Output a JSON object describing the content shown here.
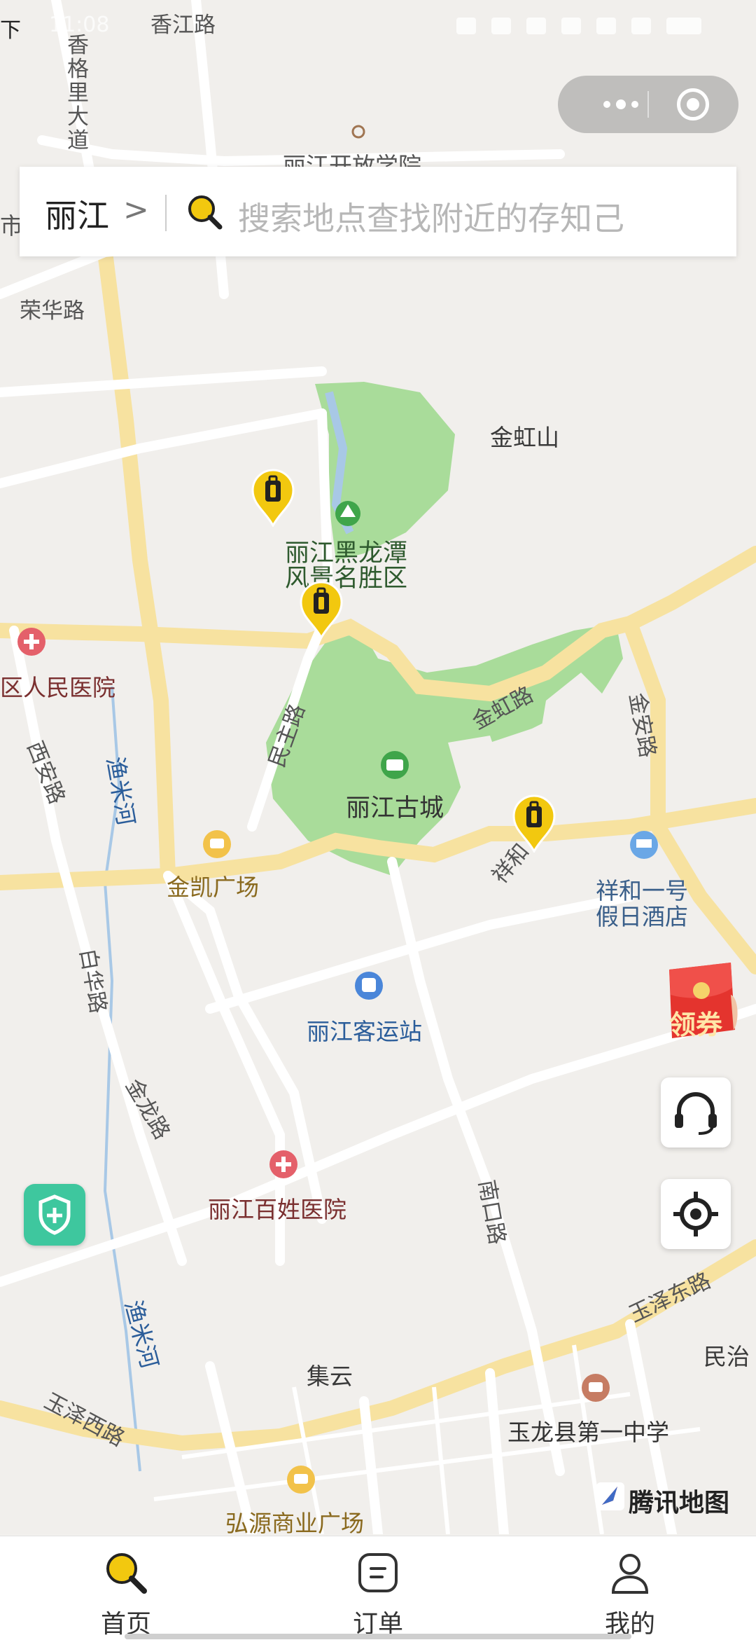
{
  "status_bar": {
    "left_text": "下",
    "time": "11:08"
  },
  "search": {
    "city": "丽江",
    "chevron": ">",
    "placeholder": "搜索地点查找附近的存知己"
  },
  "map": {
    "labels": {
      "xiangjiang_rd": "香江路",
      "shangrila_ave": "香格里大道",
      "kaifang_college": "丽江开放学院",
      "shi": "市",
      "ronghua_rd": "荣华路",
      "jinhongshan": "金虹山",
      "heilongtan_1": "丽江黑龙潭",
      "heilongtan_2": "风景名胜区",
      "renmin_hospital": "区人民医院",
      "xian_rd": "西安路",
      "yumi_river": "渔米河",
      "minzhu_rd": "民主路",
      "jinhong_rd": "金虹路",
      "jinan_rd": "金安路",
      "old_town": "丽江古城",
      "xianghe": "祥和",
      "xianghe_hotel_1": "祥和一号",
      "xianghe_hotel_2": "假日酒店",
      "jinkai_plaza": "金凯广场",
      "baihua_rd": "白华路",
      "bus_station": "丽江客运站",
      "jinlong_rd": "金龙路",
      "baixing_hospital": "丽江百姓医院",
      "nankou_rd": "南口路",
      "yumi_river_2": "渔米河",
      "yuze_east_rd": "玉泽东路",
      "minzhi": "民治",
      "jiyun": "集云",
      "yuze_west_rd": "玉泽西路",
      "yulong_school": "玉龙县第一中学",
      "hongyuan_plaza": "弘源商业广场"
    },
    "coupon_label": "领券",
    "attribution": "腾讯地图",
    "colors": {
      "park": "#a9dc9a",
      "road": "#f7e2a0",
      "pin": "#f2c80f",
      "accent": "#f2c80f"
    }
  },
  "tabs": [
    {
      "label": "首页",
      "icon": "search-icon"
    },
    {
      "label": "订单",
      "icon": "order-icon"
    },
    {
      "label": "我的",
      "icon": "user-icon"
    }
  ]
}
